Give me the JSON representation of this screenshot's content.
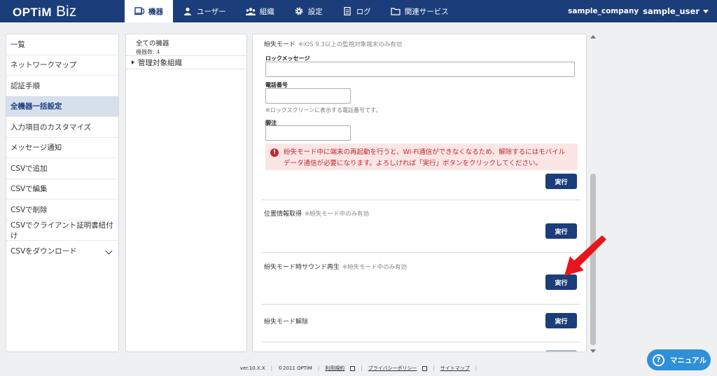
{
  "header": {
    "logo_main": "OPTiM",
    "logo_sub": "Biz",
    "nav": [
      {
        "label": "機器",
        "icon": "device-icon",
        "active": true
      },
      {
        "label": "ユーザー",
        "icon": "user-icon",
        "active": false
      },
      {
        "label": "組織",
        "icon": "organization-icon",
        "active": false
      },
      {
        "label": "設定",
        "icon": "gear-icon",
        "active": false
      },
      {
        "label": "ログ",
        "icon": "log-icon",
        "active": false
      },
      {
        "label": "関連サービス",
        "icon": "folder-icon",
        "active": false
      }
    ],
    "company": "sample_company",
    "user": "sample_user"
  },
  "sidebar": {
    "items": [
      {
        "label": "一覧"
      },
      {
        "label": "ネットワークマップ"
      },
      {
        "label": "認証手順"
      },
      {
        "label": "全機器一括設定"
      },
      {
        "label": "入力項目のカスタマイズ"
      },
      {
        "label": "メッセージ通知"
      },
      {
        "label": "CSVで追加"
      },
      {
        "label": "CSVで編集"
      },
      {
        "label": "CSVで削除"
      },
      {
        "label": "CSVでクライアント証明書紐付け"
      },
      {
        "label": "CSVをダウンロード"
      }
    ],
    "active_index": 3
  },
  "tree": {
    "all_devices": "全ての機器",
    "device_count": "機器数: 4",
    "managed_org": "管理対象組織"
  },
  "main": {
    "lost_mode": {
      "title": "紛失モード",
      "note": "※iOS 9.3以上の監視対象端末のみ有効",
      "lock_message_label": "ロックメッセージ",
      "phone_label": "電話番号",
      "phone_hint": "※ロックスクリーンに表示する電話番号です。",
      "footnote_label": "脚注",
      "alert": "紛失モード中に端末の再起動を行うと、Wi-Fi通信ができなくなるため、解除するにはモバイルデータ通信が必要になります。よろしければ「実行」ボタンをクリックしてください。",
      "button": "実行"
    },
    "location": {
      "title": "位置情報取得",
      "note": "※紛失モード中のみ有効",
      "button": "実行"
    },
    "sound": {
      "title": "紛失モード時サウンド再生",
      "note": "※紛失モード中のみ有効",
      "button": "実行"
    },
    "release": {
      "title": "紛失モード解除",
      "button": "実行"
    }
  },
  "footer": {
    "version": "ver.10.X.X",
    "copyright": "©2011 OPTiM",
    "terms": "利用規約",
    "privacy": "プライバシーポリシー",
    "sitemap": "サイトマップ"
  },
  "manual_button": "マニュアル",
  "colors": {
    "brand": "#1b3d7a",
    "alert_text": "#c0282d",
    "alert_bg": "#fbe6e6",
    "manual_bg": "#2f8fd8",
    "annotation_arrow": "#e8161c"
  }
}
